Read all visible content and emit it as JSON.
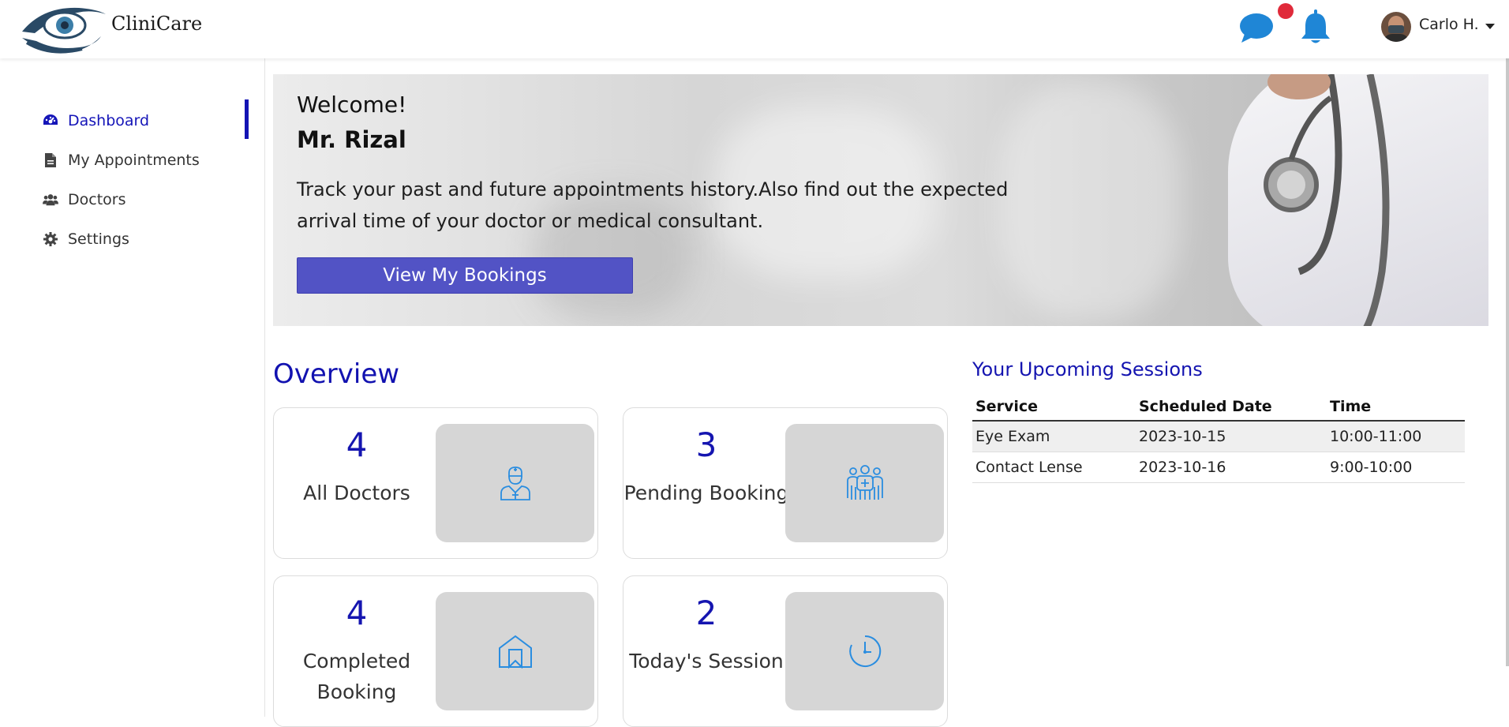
{
  "header": {
    "brand": "CliniCare",
    "logo_icon": "eye-hand-logo",
    "chat_icon": "chat-bubble-icon",
    "bell_icon": "bell-icon",
    "username": "Carlo H.",
    "accent": "#1f86d6"
  },
  "sidebar": {
    "items": [
      {
        "label": "Dashboard",
        "icon": "gauge-icon",
        "active": true
      },
      {
        "label": "My Appointments",
        "icon": "file-icon",
        "active": false
      },
      {
        "label": "Doctors",
        "icon": "users-icon",
        "active": false
      },
      {
        "label": "Settings",
        "icon": "gear-icon",
        "active": false
      }
    ]
  },
  "hero": {
    "welcome": "Welcome!",
    "name": "Mr. Rizal",
    "description": "Track your past and future appointments history.Also find out the expected arrival time of your doctor or medical consultant.",
    "button": "View My Bookings"
  },
  "overview": {
    "title": "Overview",
    "cards": [
      {
        "value": "4",
        "label": "All Doctors",
        "icon": "doctor-icon"
      },
      {
        "value": "3",
        "label": "Pending Booking",
        "icon": "group-icon"
      },
      {
        "value": "4",
        "label": "Completed Booking",
        "icon": "bookmark-house-icon"
      },
      {
        "value": "2",
        "label": "Today's Session",
        "icon": "clock-icon"
      }
    ]
  },
  "upcoming": {
    "title": "Your Upcoming Sessions",
    "columns": [
      "Service",
      "Scheduled Date",
      "Time"
    ],
    "rows": [
      [
        "Eye Exam",
        "2023-10-15",
        "10:00-11:00"
      ],
      [
        "Contact Lense",
        "2023-10-16",
        "9:00-10:00"
      ]
    ]
  },
  "colors": {
    "primary_button": "#5253c5",
    "title_blue": "#1212b0",
    "notification_dot": "#e02a3a"
  }
}
